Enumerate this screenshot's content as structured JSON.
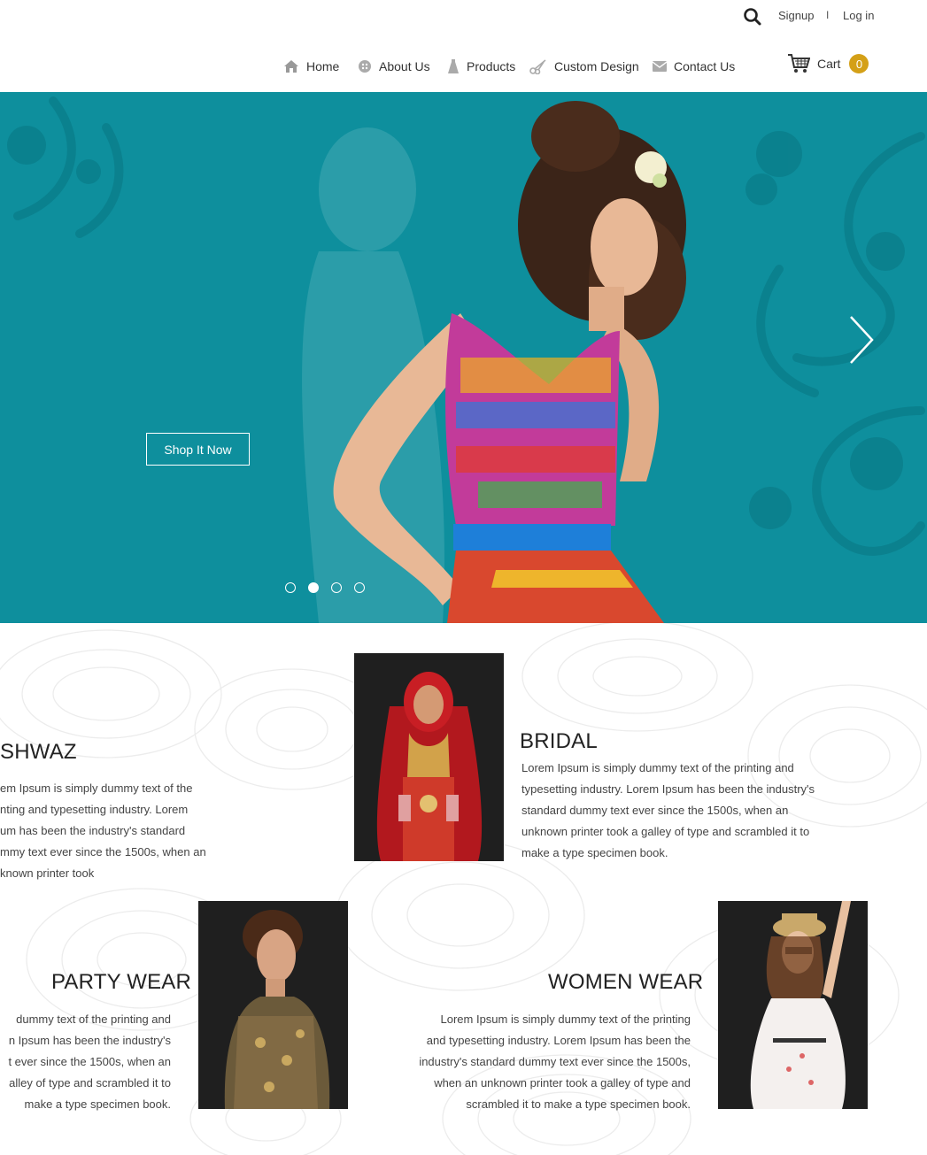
{
  "header": {
    "signup": "Signup",
    "separator": "I",
    "login": "Log in",
    "search_icon": "search-icon",
    "nav": [
      {
        "label": "Home",
        "icon": "home-icon"
      },
      {
        "label": "About Us",
        "icon": "circle-dots-icon"
      },
      {
        "label": "Products",
        "icon": "dress-icon"
      },
      {
        "label": "Custom Design",
        "icon": "scissors-icon"
      },
      {
        "label": "Contact Us",
        "icon": "envelope-icon"
      }
    ],
    "cart": {
      "label": "Cart",
      "count": "0",
      "icon": "cart-icon"
    }
  },
  "hero": {
    "button": "Shop It Now",
    "slides": 4,
    "active_slide": 2,
    "colors": {
      "background": "#0e8f9d",
      "accent": "#d4a017"
    }
  },
  "categories": [
    {
      "title": "SHWAZ",
      "text": [
        "em Ipsum is simply dummy text of the",
        "nting and typesetting industry. Lorem",
        "um has been the industry's standard",
        "mmy text ever since the 1500s, when an",
        "known printer took"
      ]
    },
    {
      "title": "BRIDAL",
      "text": [
        "Lorem Ipsum is simply dummy text of the printing and",
        "typesetting industry. Lorem Ipsum has been the industry's",
        "standard dummy text ever since the 1500s, when an",
        "unknown printer took a galley of type and scrambled it to",
        "make a type specimen book."
      ]
    },
    {
      "title": "PARTY WEAR",
      "text": [
        "dummy text of the printing and",
        "n Ipsum has been the industry's",
        "t ever since the 1500s, when an",
        "alley of type and scrambled it to",
        "make a type specimen book."
      ]
    },
    {
      "title": "WOMEN WEAR",
      "text": [
        "Lorem Ipsum is simply dummy text of the printing",
        "and typesetting industry. Lorem Ipsum has been the",
        "industry's standard dummy text ever since the 1500s,",
        "when an unknown printer took a galley of type and",
        "scrambled it to make a type specimen book."
      ]
    }
  ]
}
